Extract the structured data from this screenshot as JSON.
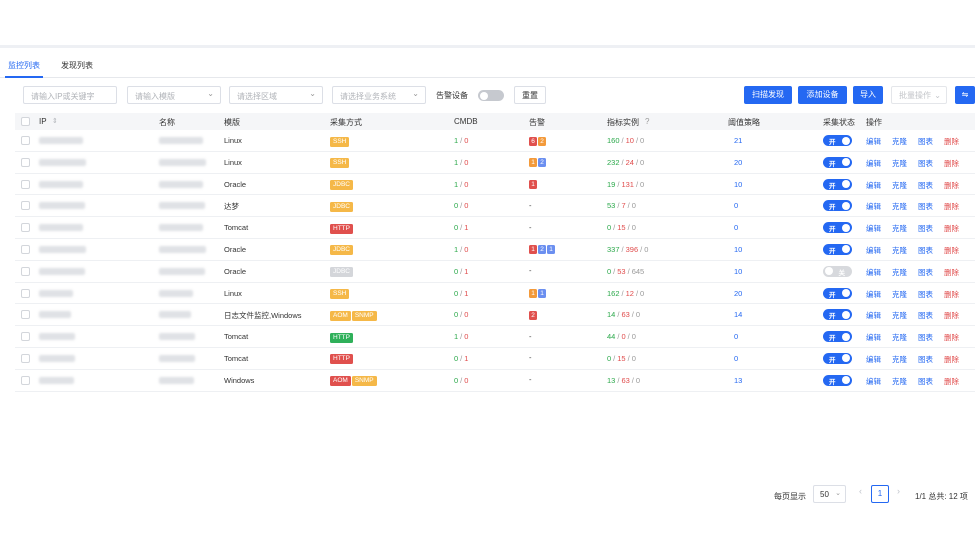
{
  "tabs": [
    "监控列表",
    "发现列表"
  ],
  "toolbar": {
    "search_placeholder": "请输入IP或关键字",
    "template_placeholder": "请输入模版",
    "region_placeholder": "请选择区域",
    "business_placeholder": "请选择业务系统",
    "alarm_device_label": "告警设备",
    "reset": "重置",
    "scan": "扫描发现",
    "add": "添加设备",
    "import": "导入",
    "batch": "批量操作",
    "settings_glyph": "⇋"
  },
  "headers": {
    "ip": "IP",
    "sort_glyph": "⇕",
    "name": "名称",
    "template": "模版",
    "method": "采集方式",
    "cmdb": "CMDB",
    "alarm": "告警",
    "metric": "指标实例",
    "help_glyph": "?",
    "threshold": "阈值策略",
    "status": "采集状态",
    "ops": "操作"
  },
  "toggle_text": {
    "on": "开",
    "off": "关"
  },
  "actions": {
    "edit": "编辑",
    "clone": "克隆",
    "chart": "图表",
    "delete": "删除"
  },
  "colors": {
    "ssh": "#f5b848",
    "jdbc": "#f5b848",
    "http": "#e0504d",
    "http_green": "#2fb05a",
    "aom": "#e0504d",
    "snmp": "#f5b848",
    "jdbc_off": "#d4d6da",
    "badge_red": "#e0504d",
    "badge_orange": "#f39a3b",
    "badge_blue": "#6b8ff0"
  },
  "rows": [
    {
      "template": "Linux",
      "methods": [
        {
          "t": "SSH",
          "c": "ssh"
        }
      ],
      "cmdb": [
        "1",
        "0"
      ],
      "alarm": [
        [
          "6",
          "badge_red"
        ],
        [
          "2",
          "badge_orange"
        ]
      ],
      "metric": [
        "160",
        "10",
        "0"
      ],
      "threshold": "21",
      "status": "on"
    },
    {
      "template": "Linux",
      "methods": [
        {
          "t": "SSH",
          "c": "ssh"
        }
      ],
      "cmdb": [
        "1",
        "0"
      ],
      "alarm": [
        [
          "1",
          "badge_orange"
        ],
        [
          "2",
          "badge_blue"
        ]
      ],
      "metric": [
        "232",
        "24",
        "0"
      ],
      "threshold": "20",
      "status": "on"
    },
    {
      "template": "Oracle",
      "methods": [
        {
          "t": "JDBC",
          "c": "jdbc"
        }
      ],
      "cmdb": [
        "1",
        "0"
      ],
      "alarm": [
        [
          "1",
          "badge_red"
        ]
      ],
      "metric": [
        "19",
        "131",
        "0"
      ],
      "threshold": "10",
      "status": "on"
    },
    {
      "template": "达梦",
      "methods": [
        {
          "t": "JDBC",
          "c": "jdbc"
        }
      ],
      "cmdb": [
        "0",
        "0"
      ],
      "alarm": [],
      "metric": [
        "53",
        "7",
        "0"
      ],
      "threshold": "0",
      "status": "on"
    },
    {
      "template": "Tomcat",
      "methods": [
        {
          "t": "HTTP",
          "c": "http"
        }
      ],
      "cmdb": [
        "0",
        "1"
      ],
      "alarm": [],
      "metric": [
        "0",
        "15",
        "0"
      ],
      "threshold": "0",
      "status": "on"
    },
    {
      "template": "Oracle",
      "methods": [
        {
          "t": "JDBC",
          "c": "jdbc"
        }
      ],
      "cmdb": [
        "1",
        "0"
      ],
      "alarm": [
        [
          "1",
          "badge_red"
        ],
        [
          "2",
          "badge_blue"
        ],
        [
          "1",
          "badge_blue"
        ]
      ],
      "metric": [
        "337",
        "396",
        "0"
      ],
      "threshold": "10",
      "status": "on"
    },
    {
      "template": "Oracle",
      "methods": [
        {
          "t": "JDBC",
          "c": "jdbc_off"
        }
      ],
      "cmdb": [
        "0",
        "1"
      ],
      "alarm": [],
      "metric": [
        "0",
        "53",
        "645"
      ],
      "threshold": "10",
      "status": "off"
    },
    {
      "template": "Linux",
      "methods": [
        {
          "t": "SSH",
          "c": "ssh"
        }
      ],
      "cmdb": [
        "0",
        "1"
      ],
      "alarm": [
        [
          "1",
          "badge_orange"
        ],
        [
          "1",
          "badge_blue"
        ]
      ],
      "metric": [
        "162",
        "12",
        "0"
      ],
      "threshold": "20",
      "status": "on"
    },
    {
      "template": "日志文件监控,Windows",
      "methods": [
        {
          "t": "AOM",
          "c": "ssh"
        },
        {
          "t": "SNMP",
          "c": "snmp"
        }
      ],
      "cmdb": [
        "0",
        "0"
      ],
      "alarm": [
        [
          "2",
          "badge_red"
        ]
      ],
      "metric": [
        "14",
        "63",
        "0"
      ],
      "threshold": "14",
      "status": "on"
    },
    {
      "template": "Tomcat",
      "methods": [
        {
          "t": "HTTP",
          "c": "http_green"
        }
      ],
      "cmdb": [
        "1",
        "0"
      ],
      "alarm": [],
      "metric": [
        "44",
        "0",
        "0"
      ],
      "threshold": "0",
      "status": "on"
    },
    {
      "template": "Tomcat",
      "methods": [
        {
          "t": "HTTP",
          "c": "http"
        }
      ],
      "cmdb": [
        "0",
        "1"
      ],
      "alarm": [],
      "metric": [
        "0",
        "15",
        "0"
      ],
      "threshold": "0",
      "status": "on"
    },
    {
      "template": "Windows",
      "methods": [
        {
          "t": "AOM",
          "c": "aom"
        },
        {
          "t": "SNMP",
          "c": "snmp"
        }
      ],
      "cmdb": [
        "0",
        "0"
      ],
      "alarm": [],
      "metric": [
        "13",
        "63",
        "0"
      ],
      "threshold": "13",
      "status": "on"
    }
  ],
  "dash": "-",
  "slash": "/",
  "pagination": {
    "per_page_label": "每页显示",
    "per_page": "50",
    "prev": "‹",
    "next": "›",
    "current": "1",
    "summary": "1/1 总共: 12 项"
  }
}
